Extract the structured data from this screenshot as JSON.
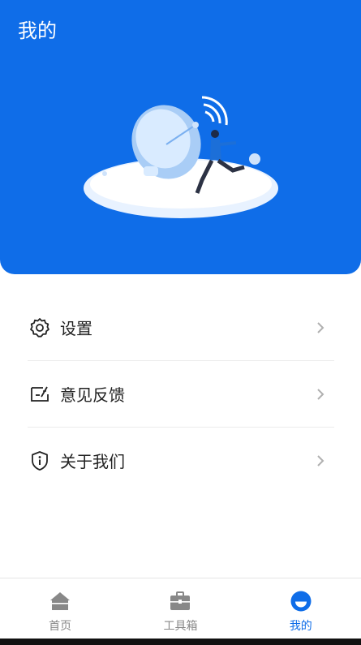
{
  "header": {
    "title": "我的"
  },
  "menu": {
    "items": [
      {
        "label": "设置",
        "icon": "gear-icon"
      },
      {
        "label": "意见反馈",
        "icon": "feedback-icon"
      },
      {
        "label": "关于我们",
        "icon": "info-shield-icon"
      }
    ]
  },
  "tabbar": {
    "items": [
      {
        "label": "首页",
        "icon": "home-icon",
        "active": false
      },
      {
        "label": "工具箱",
        "icon": "toolbox-icon",
        "active": false
      },
      {
        "label": "我的",
        "icon": "profile-icon",
        "active": true
      }
    ]
  },
  "colors": {
    "accent": "#0f6de8",
    "inactive": "#888888",
    "text": "#222222"
  }
}
